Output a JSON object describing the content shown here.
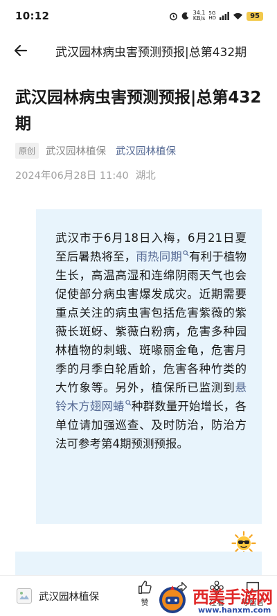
{
  "status_bar": {
    "time": "10:12",
    "speed_value": "34.1",
    "speed_unit": "KB/s",
    "network_top": "5G",
    "network_bottom": "HD",
    "battery": "95"
  },
  "nav": {
    "title": "武汉园林病虫害预测预报|总第432期"
  },
  "article": {
    "title": "武汉园林病虫害预测预报|总第432期",
    "original_badge": "原创",
    "author": "武汉园林植保",
    "account": "武汉园林植保",
    "date": "2024年06月28日 11:40",
    "location": "湖北",
    "body_part1": "武汉市于6月18日入梅，6月21日夏至后暑热将至，",
    "keyword1": "雨热同期",
    "body_part2": "有利于植物生长，高温高湿和连绵阴雨天气也会促使部分病虫害爆发成灾。近期需要重点关注的病虫害包括危害紫薇的紫薇长斑蚜、紫薇白粉病，危害多种园林植物的刺蛾、斑喙丽金龟，危害月季的月季白轮盾蚧，危害各种竹类的大竹象等。另外，植保所已监测到",
    "keyword2": "悬铃木方翅网蝽",
    "body_part3": "种群数量开始增长，各单位请加强巡查、及时防治，防治方法可参考第4期预测预报。"
  },
  "bottom_bar": {
    "account": "武汉园林植保",
    "like_label": "赞",
    "share_label": "享",
    "watch_label": "在看",
    "comment_label": "写留言"
  },
  "watermark": {
    "text": "西美手游网",
    "url": "www.hanxm.com"
  },
  "colors": {
    "link": "#576b95",
    "content_bg": "#e8f4fc",
    "battery": "#f2c94c",
    "watermark_red": "#e02828",
    "watermark_blue": "#2a4da8"
  }
}
